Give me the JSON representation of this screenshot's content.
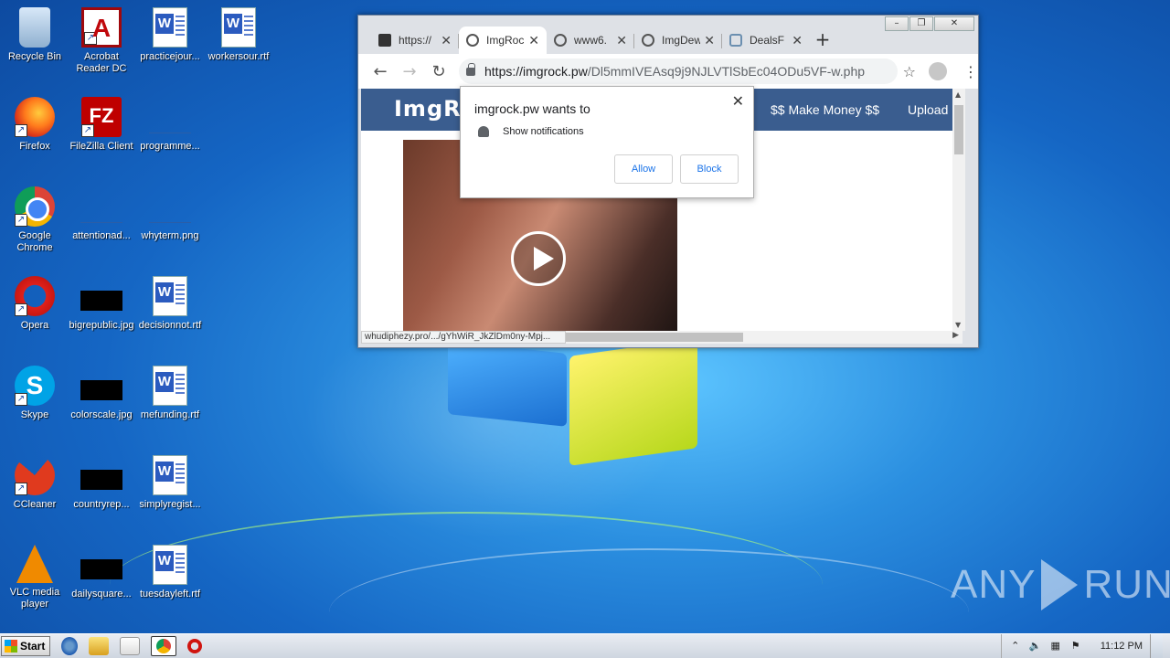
{
  "desktop": {
    "icons": [
      {
        "label": "Recycle Bin"
      },
      {
        "label": "Acrobat Reader DC"
      },
      {
        "label": "practicejour..."
      },
      {
        "label": "workersour.rtf"
      },
      {
        "label": "Firefox"
      },
      {
        "label": "FileZilla Client"
      },
      {
        "label": "programme..."
      },
      {
        "label": "Google Chrome"
      },
      {
        "label": "attentionad..."
      },
      {
        "label": "whyterm.png"
      },
      {
        "label": "Opera"
      },
      {
        "label": "bigrepublic.jpg"
      },
      {
        "label": "decisionnot.rtf"
      },
      {
        "label": "Skype"
      },
      {
        "label": "colorscale.jpg"
      },
      {
        "label": "mefunding.rtf"
      },
      {
        "label": "CCleaner"
      },
      {
        "label": "countryrep..."
      },
      {
        "label": "simplyregist..."
      },
      {
        "label": "VLC media player"
      },
      {
        "label": "dailysquare..."
      },
      {
        "label": "tuesdayleft.rtf"
      }
    ]
  },
  "browser": {
    "tabs": [
      {
        "title": "https://",
        "icon": "file-code-icon",
        "active": false
      },
      {
        "title": "ImgRock",
        "icon": "globe-icon",
        "active": true
      },
      {
        "title": "www6.",
        "icon": "globe-icon",
        "active": false
      },
      {
        "title": "ImgDew",
        "icon": "globe-icon",
        "active": false
      },
      {
        "title": "DealsF",
        "icon": "deals-icon",
        "active": false
      }
    ],
    "new_tab_label": "+",
    "url_host": "https://imgrock.pw",
    "url_path": "/Dl5mmIVEAsq9j9NJLVTlSbEc04ODu5VF-w.php",
    "site": {
      "logo": "ImgR",
      "nav_money": "$$ Make Money $$",
      "nav_upload": "Upload F"
    },
    "status_url": "whudiphezy.pro/.../gYhWiR_JkZlDm0ny-Mpj..."
  },
  "notification": {
    "title": "imgrock.pw wants to",
    "description": "Show notifications",
    "allow_label": "Allow",
    "block_label": "Block"
  },
  "watermark": {
    "left": "ANY",
    "right": "RUN"
  },
  "taskbar": {
    "start_label": "Start",
    "clock": "11:12 PM"
  }
}
